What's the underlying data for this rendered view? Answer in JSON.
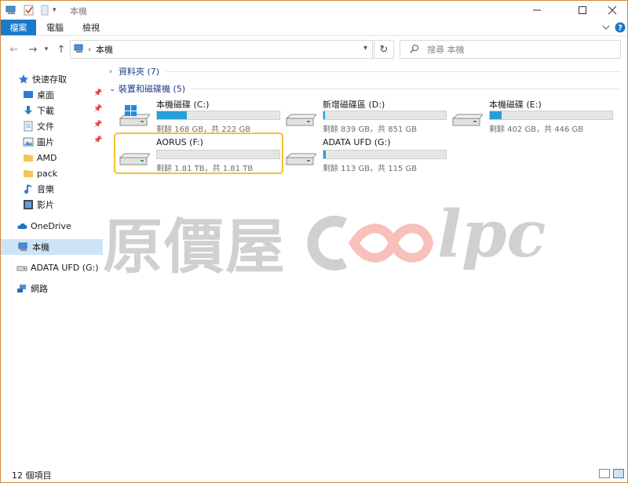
{
  "window": {
    "title": "本機",
    "colors": {
      "accent": "#1979ca",
      "progress": "#26a0da",
      "highlight": "#f5c22b",
      "group_header": "#1e3a8a"
    }
  },
  "ribbon": {
    "tabs": [
      {
        "label": "檔案",
        "active": true
      },
      {
        "label": "電腦",
        "active": false
      },
      {
        "label": "檢視",
        "active": false
      }
    ]
  },
  "address": {
    "path": "本機",
    "search_placeholder": "搜尋 本機"
  },
  "sidebar": {
    "items": [
      {
        "label": "快速存取",
        "icon": "star-icon",
        "pinned": false
      },
      {
        "label": "桌面",
        "icon": "desktop-icon",
        "pinned": true
      },
      {
        "label": "下載",
        "icon": "download-icon",
        "pinned": true
      },
      {
        "label": "文件",
        "icon": "document-icon",
        "pinned": true
      },
      {
        "label": "圖片",
        "icon": "picture-icon",
        "pinned": true
      },
      {
        "label": "AMD",
        "icon": "folder-icon",
        "pinned": false
      },
      {
        "label": "pack",
        "icon": "folder-icon",
        "pinned": false
      },
      {
        "label": "音樂",
        "icon": "music-icon",
        "pinned": false
      },
      {
        "label": "影片",
        "icon": "video-icon",
        "pinned": false
      },
      {
        "label": "OneDrive",
        "icon": "cloud-icon",
        "pinned": false
      },
      {
        "label": "本機",
        "icon": "computer-icon",
        "pinned": false,
        "selected": true
      },
      {
        "label": "ADATA UFD (G:)",
        "icon": "usb-drive-icon",
        "pinned": false
      },
      {
        "label": "網路",
        "icon": "network-icon",
        "pinned": false
      }
    ]
  },
  "content": {
    "groups": [
      {
        "label": "資料夾 (7)",
        "expanded": false
      },
      {
        "label": "裝置和磁碟機 (5)",
        "expanded": true
      }
    ],
    "drives": [
      {
        "name": "本機磁碟 (C:)",
        "free_text": "剩餘 168 GB，共 222 GB",
        "used_fraction": 0.243,
        "icon": "windows-drive-icon"
      },
      {
        "name": "新增磁碟區 (D:)",
        "free_text": "剩餘 839 GB，共 851 GB",
        "used_fraction": 0.014,
        "icon": "drive-icon"
      },
      {
        "name": "本機磁碟 (E:)",
        "free_text": "剩餘 402 GB，共 446 GB",
        "used_fraction": 0.099,
        "icon": "drive-icon"
      },
      {
        "name": "AORUS (F:)",
        "free_text": "剩餘 1.81 TB，共 1.81 TB",
        "used_fraction": 0.0,
        "icon": "drive-icon",
        "highlighted": true
      },
      {
        "name": "ADATA UFD (G:)",
        "free_text": "剩餘 113 GB，共 115 GB",
        "used_fraction": 0.017,
        "icon": "drive-icon"
      }
    ]
  },
  "watermark": {
    "cjk": "原價屋",
    "latin": "lpc"
  },
  "status": {
    "count": "12 個項目"
  }
}
